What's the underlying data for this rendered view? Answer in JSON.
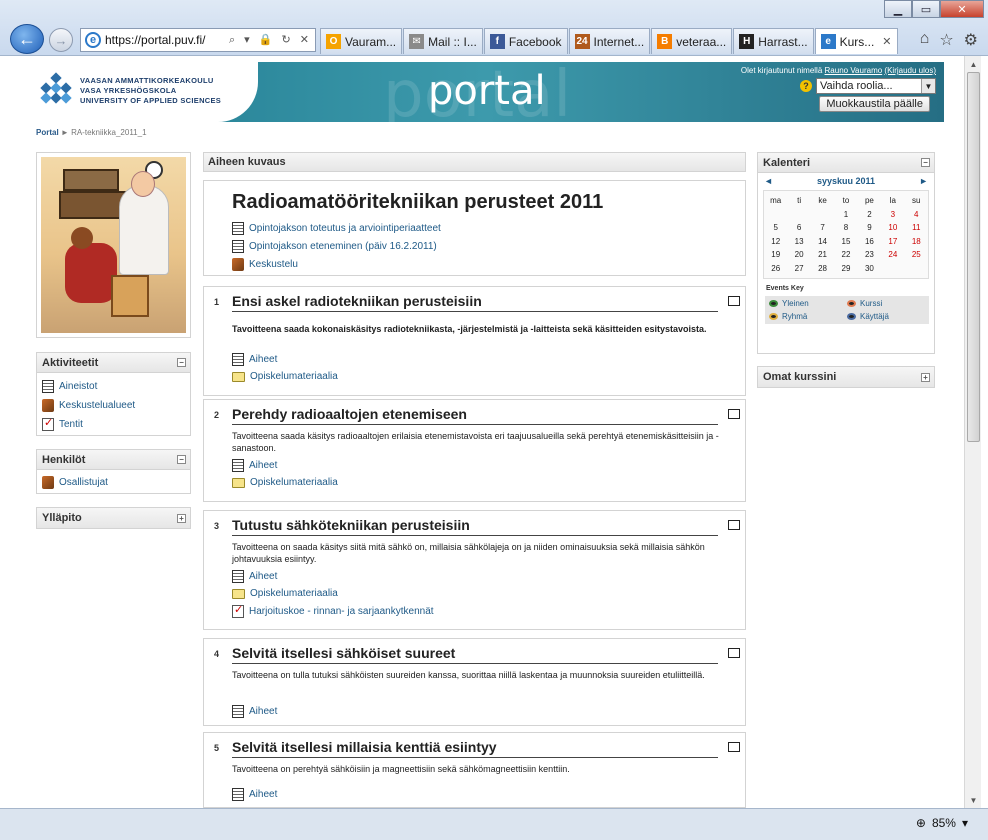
{
  "browser": {
    "url": "https://portal.puv.fi/",
    "url_tools": "⌕ ▾ 🔒 ↻ ✕",
    "tabs": [
      {
        "label": "Vauram...",
        "icon_color": "#f5a300",
        "icon_text": "O"
      },
      {
        "label": "Mail :: I...",
        "icon_color": "#8a8a8a",
        "icon_text": "✉"
      },
      {
        "label": "Facebook",
        "icon_color": "#3b5998",
        "icon_text": "f"
      },
      {
        "label": "Internet...",
        "icon_color": "#b05a1c",
        "icon_text": "24"
      },
      {
        "label": "veteraa...",
        "icon_color": "#f57d00",
        "icon_text": "B"
      },
      {
        "label": "Harrast...",
        "icon_color": "#222222",
        "icon_text": "H"
      },
      {
        "label": "Kurs...",
        "icon_color": "#2c79c9",
        "icon_text": "e",
        "active": true
      }
    ],
    "zoom": "85%"
  },
  "header": {
    "logo_lines": [
      "VAASAN AMMATTIKORKEAKOULU",
      "VASA YRKESHÖGSKOLA",
      "UNIVERSITY OF APPLIED SCIENCES"
    ],
    "portal_title": "portal",
    "logged_in_prefix": "Olet kirjautunut nimellä",
    "user_name": "Rauno Vauramo",
    "logout": "(Kirjaudu ulos)",
    "role_select": "Vaihda roolia...",
    "edit_button": "Muokkaustila päälle"
  },
  "breadcrumb": {
    "home": "Portal",
    "separator": "►",
    "current": "RA-tekniikka_2011_1"
  },
  "left": {
    "activities": {
      "title": "Aktiviteetit",
      "items": [
        "Aineistot",
        "Keskustelualueet",
        "Tentit"
      ]
    },
    "people": {
      "title": "Henkilöt",
      "items": [
        "Osallistujat"
      ]
    },
    "admin": {
      "title": "Ylläpito"
    }
  },
  "main": {
    "header": "Aiheen kuvaus",
    "course_title": "Radioamatööritekniikan perusteet 2011",
    "intro_links": [
      "Opintojakson toteutus ja arviointiperiaatteet",
      "Opintojakson eteneminen (päiv 16.2.2011)",
      "Keskustelu"
    ],
    "sections": [
      {
        "num": "1",
        "title": "Ensi askel radiotekniikan perusteisiin",
        "desc": "Tavoitteena saada kokonaiskäsitys radiotekniikasta, -järjestelmistä ja -laitteista sekä käsitteiden esitystavoista.",
        "links": [
          "Aiheet",
          "Opiskelumateriaalia"
        ]
      },
      {
        "num": "2",
        "title": "Perehdy radioaaltojen etenemiseen",
        "desc": "Tavoitteena saada käsitys radioaaltojen erilaisia etenemistavoista eri taajuusalueilla sekä perehtyä etenemiskäsitteisiin ja -sanastoon.",
        "links": [
          "Aiheet",
          "Opiskelumateriaalia"
        ]
      },
      {
        "num": "3",
        "title": "Tutustu sähkötekniikan perusteisiin",
        "desc": "Tavoitteena on saada käsitys siitä mitä sähkö on, millaisia sähkölajeja on ja niiden ominaisuuksia sekä millaisia sähkön johtavuuksia esiintyy.",
        "links": [
          "Aiheet",
          "Opiskelumateriaalia",
          "Harjoituskoe - rinnan- ja sarjaankytkennät"
        ]
      },
      {
        "num": "4",
        "title": "Selvitä itsellesi sähköiset suureet",
        "desc": "Tavoitteena on tulla tutuksi sähköisten suureiden kanssa, suorittaa niillä laskentaa ja muunnoksia suureiden etuliitteillä.",
        "links": [
          "Aiheet"
        ]
      },
      {
        "num": "5",
        "title": "Selvitä itsellesi millaisia kenttiä esiintyy",
        "desc": "Tavoitteena on perehtyä sähköisiin ja magneettisiin sekä sähkömagneettisiin kenttiin.",
        "links": [
          "Aiheet"
        ]
      }
    ]
  },
  "right": {
    "calendar": {
      "title": "Kalenteri",
      "prev": "◄",
      "next": "►",
      "month": "syyskuu 2011",
      "weekdays": [
        "ma",
        "ti",
        "ke",
        "to",
        "pe",
        "la",
        "su"
      ],
      "days": [
        "",
        "",
        "",
        "1",
        "2",
        "3",
        "4",
        "5",
        "6",
        "7",
        "8",
        "9",
        "10",
        "11",
        "12",
        "13",
        "14",
        "15",
        "16",
        "17",
        "18",
        "19",
        "20",
        "21",
        "22",
        "23",
        "24",
        "25",
        "26",
        "27",
        "28",
        "29",
        "30",
        "",
        ""
      ],
      "events_key_title": "Events Key",
      "events_key": [
        "Yleinen",
        "Kurssi",
        "Ryhmä",
        "Käyttäjä"
      ],
      "event_colors": [
        "#3a8a3a",
        "#e07a50",
        "#e0b040",
        "#4a6aa0"
      ]
    },
    "my_courses": {
      "title": "Omat kurssini"
    }
  }
}
